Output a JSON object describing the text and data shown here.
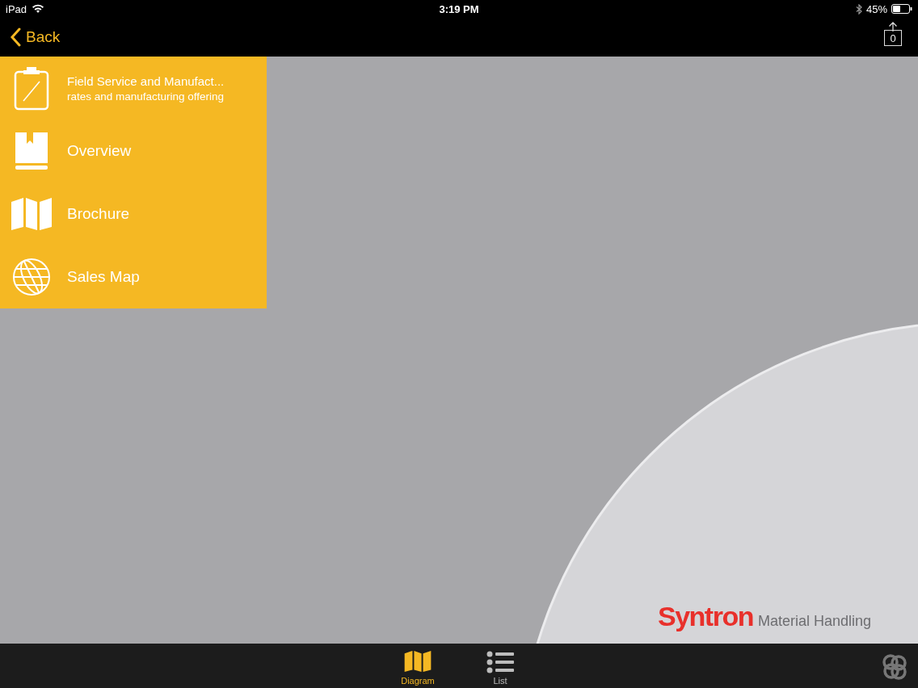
{
  "status_bar": {
    "device": "iPad",
    "time": "3:19 PM",
    "battery": "45%"
  },
  "nav": {
    "back": "Back",
    "share_count": "0"
  },
  "menu": [
    {
      "kind": "detail",
      "title": "Field Service and Manufact...",
      "subtitle": "rates and manufacturing offering"
    },
    {
      "kind": "plain",
      "title": "Overview"
    },
    {
      "kind": "plain",
      "title": "Brochure"
    },
    {
      "kind": "plain",
      "title": "Sales Map"
    }
  ],
  "logo": {
    "brand": "Syntron",
    "tagline": "Material Handling"
  },
  "tabs": [
    {
      "label": "Diagram",
      "selected": true
    },
    {
      "label": "List",
      "selected": false
    }
  ]
}
